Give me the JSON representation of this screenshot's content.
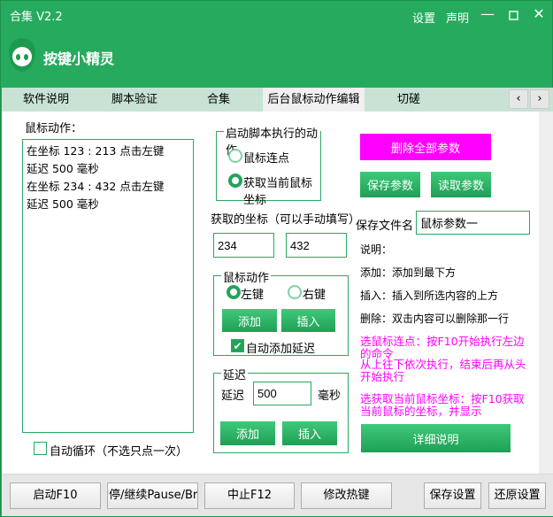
{
  "window": {
    "title": "合集 V2.2",
    "settings": "设置",
    "statement": "声明",
    "minimize_icon": "minimize-icon",
    "maximize_icon": "maximize-icon",
    "close_icon": "close-icon"
  },
  "brand": {
    "name": "按键小精灵"
  },
  "tabs": [
    {
      "label": "软件说明"
    },
    {
      "label": "脚本验证"
    },
    {
      "label": "合集"
    },
    {
      "label": "后台鼠标动作编辑",
      "active": true
    },
    {
      "label": "切磋"
    }
  ],
  "tab_nav": {
    "prev": "‹",
    "next": "›"
  },
  "left": {
    "label": "鼠标动作：",
    "actions": [
      "在坐标 123 : 213 点击左键",
      "延迟 500 毫秒",
      "在坐标 234 : 432 点击左键",
      "延迟 500 毫秒"
    ],
    "loop_label": "自动循环（不选只点一次）",
    "loop_checked": false
  },
  "start_group": {
    "title": "启动脚本执行的动作",
    "option1": "鼠标连点",
    "option2": "获取当前鼠标坐标",
    "selected": "获取当前鼠标坐标"
  },
  "coords": {
    "label": "获取的坐标（可以手动填写）",
    "x": "234",
    "y": "432"
  },
  "mouse_group": {
    "title": "鼠标动作",
    "left": "左键",
    "right": "右键",
    "selected": "左键",
    "add": "添加",
    "insert": "插入",
    "auto_delay": "自动添加延迟",
    "auto_delay_checked": true
  },
  "delay_group": {
    "title": "延迟",
    "label": "延迟",
    "value": "500",
    "unit": "毫秒",
    "add": "添加",
    "insert": "插入"
  },
  "right": {
    "delete_all": "删除全部参数",
    "save_params": "保存参数",
    "load_params": "读取参数",
    "filename_label": "保存文件名",
    "filename": "鼠标参数一",
    "help_title": "说明：",
    "help_add": "添加：添加到最下方",
    "help_insert": "插入：插入到所选内容的上方",
    "help_delete": "删除：双击内容可以删除那一行",
    "note1": "选鼠标连点：按F10开始执行左边的命令",
    "note2": "从上往下依次执行，结束后再从头开始执行",
    "note3": "选获取当前鼠标坐标：按F10获取当前鼠标的坐标，并显示",
    "details": "详细说明"
  },
  "bottom": {
    "start": "启动F10",
    "pause": "暂停/继续Pause/Break",
    "stop": "中止F12",
    "hotkey": "修改热键",
    "save": "保存设置",
    "restore": "还原设置"
  },
  "colors": {
    "green": "#26ab5e",
    "magenta": "#ff00ff"
  }
}
